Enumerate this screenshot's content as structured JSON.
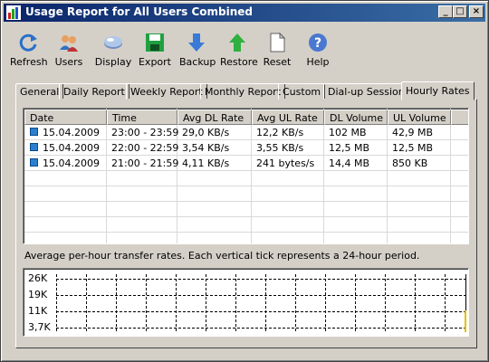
{
  "window": {
    "title": "Usage Report for All Users Combined"
  },
  "titlebar_buttons": {
    "minimize": "_",
    "maximize": "□",
    "close": "×"
  },
  "toolbar": [
    {
      "key": "refresh",
      "label": "Refresh",
      "icon": "refresh-icon"
    },
    {
      "key": "users",
      "label": "Users",
      "icon": "users-icon"
    },
    {
      "key": "display",
      "label": "Display",
      "icon": "display-icon"
    },
    {
      "key": "export",
      "label": "Export",
      "icon": "export-icon"
    },
    {
      "key": "backup",
      "label": "Backup",
      "icon": "backup-icon"
    },
    {
      "key": "restore",
      "label": "Restore",
      "icon": "restore-icon"
    },
    {
      "key": "reset",
      "label": "Reset",
      "icon": "reset-icon"
    },
    {
      "key": "help",
      "label": "Help",
      "icon": "help-icon"
    }
  ],
  "tabs": [
    {
      "label": "General",
      "active": false
    },
    {
      "label": "Daily Report",
      "active": false
    },
    {
      "label": "Weekly Report",
      "active": false
    },
    {
      "label": "Monthly Report",
      "active": false
    },
    {
      "label": "Custom",
      "active": false
    },
    {
      "label": "Dial-up Sessions",
      "active": false
    },
    {
      "label": "Hourly Rates",
      "active": true
    }
  ],
  "table": {
    "columns": [
      "Date",
      "Time",
      "Avg DL Rate",
      "Avg UL Rate",
      "DL Volume",
      "UL Volume"
    ],
    "rows": [
      [
        "15.04.2009",
        "23:00 - 23:59",
        "29,0 KB/s",
        "12,2 KB/s",
        "102 MB",
        "42,9 MB"
      ],
      [
        "15.04.2009",
        "22:00 - 22:59",
        "3,54 KB/s",
        "3,55 KB/s",
        "12,5 MB",
        "12,5 MB"
      ],
      [
        "15.04.2009",
        "21:00 - 21:59",
        "4,11 KB/s",
        "241 bytes/s",
        "14,4 MB",
        "850 KB"
      ]
    ]
  },
  "caption": "Average per-hour transfer rates. Each vertical tick represents a 24-hour period.",
  "graph": {
    "y_labels": [
      "26K",
      "19K",
      "11K",
      "3,7K"
    ],
    "bar_color": "#e0c000"
  },
  "colors": {
    "title_start": "#0a246a",
    "title_end": "#3a6ea5",
    "row_icon": "#2a7fd0"
  }
}
